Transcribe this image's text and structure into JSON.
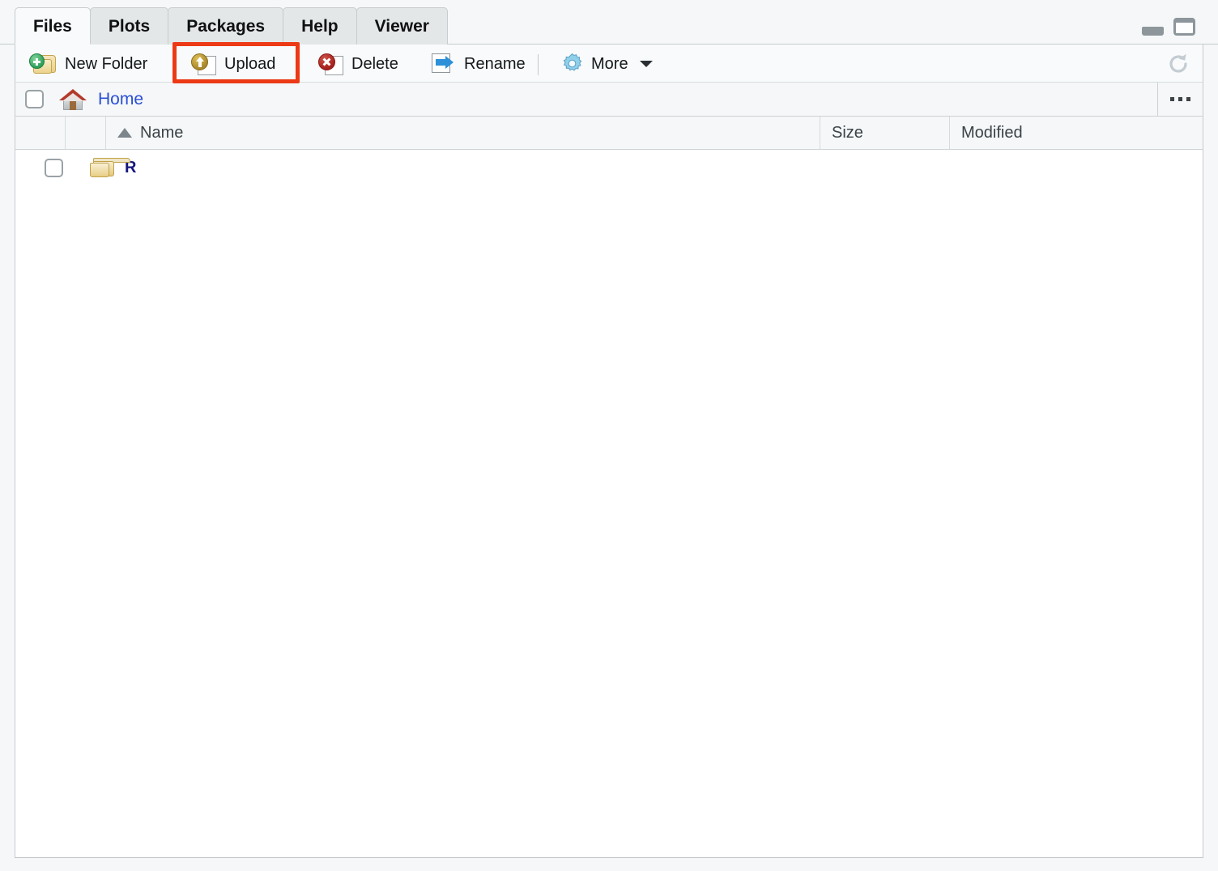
{
  "window": {
    "minimize_icon": "minimize-icon",
    "maximize_icon": "maximize-icon"
  },
  "tabs": [
    {
      "label": "Files",
      "active": true
    },
    {
      "label": "Plots",
      "active": false
    },
    {
      "label": "Packages",
      "active": false
    },
    {
      "label": "Help",
      "active": false
    },
    {
      "label": "Viewer",
      "active": false
    }
  ],
  "toolbar": {
    "new_folder_label": "New Folder",
    "new_folder_icon": "new-folder-icon",
    "upload_label": "Upload",
    "upload_icon": "upload-icon",
    "delete_label": "Delete",
    "delete_icon": "delete-icon",
    "rename_label": "Rename",
    "rename_icon": "rename-icon",
    "more_label": "More",
    "more_icon": "gear-icon",
    "more_caret_icon": "chevron-down-icon",
    "refresh_icon": "refresh-icon"
  },
  "highlight": {
    "target": "Upload",
    "color": "#ec3a16"
  },
  "pathbar": {
    "home_icon": "home-icon",
    "crumb": "Home",
    "overflow_icon": "ellipsis-icon"
  },
  "table": {
    "columns": {
      "name": "Name",
      "size": "Size",
      "modified": "Modified"
    },
    "sort_icon": "sort-ascending-icon",
    "rows": [
      {
        "icon": "folder-icon",
        "name": "R",
        "size": "",
        "modified": ""
      }
    ]
  }
}
